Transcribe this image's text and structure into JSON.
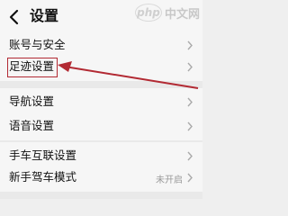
{
  "header": {
    "title": "设置",
    "back_icon": "chevron-left-icon",
    "watermark_logo": "php",
    "watermark_text": "中文网"
  },
  "settings": [
    {
      "label": "账号与安全",
      "value": ""
    },
    {
      "label": "足迹设置",
      "value": ""
    },
    {
      "label": "导航设置",
      "value": ""
    },
    {
      "label": "语音设置",
      "value": ""
    },
    {
      "label": "手车互联设置",
      "value": ""
    },
    {
      "label": "新手驾车模式",
      "value": "未开启"
    }
  ],
  "annotation": {
    "highlight_color": "#b22a33",
    "highlighted_item": "足迹设置"
  }
}
